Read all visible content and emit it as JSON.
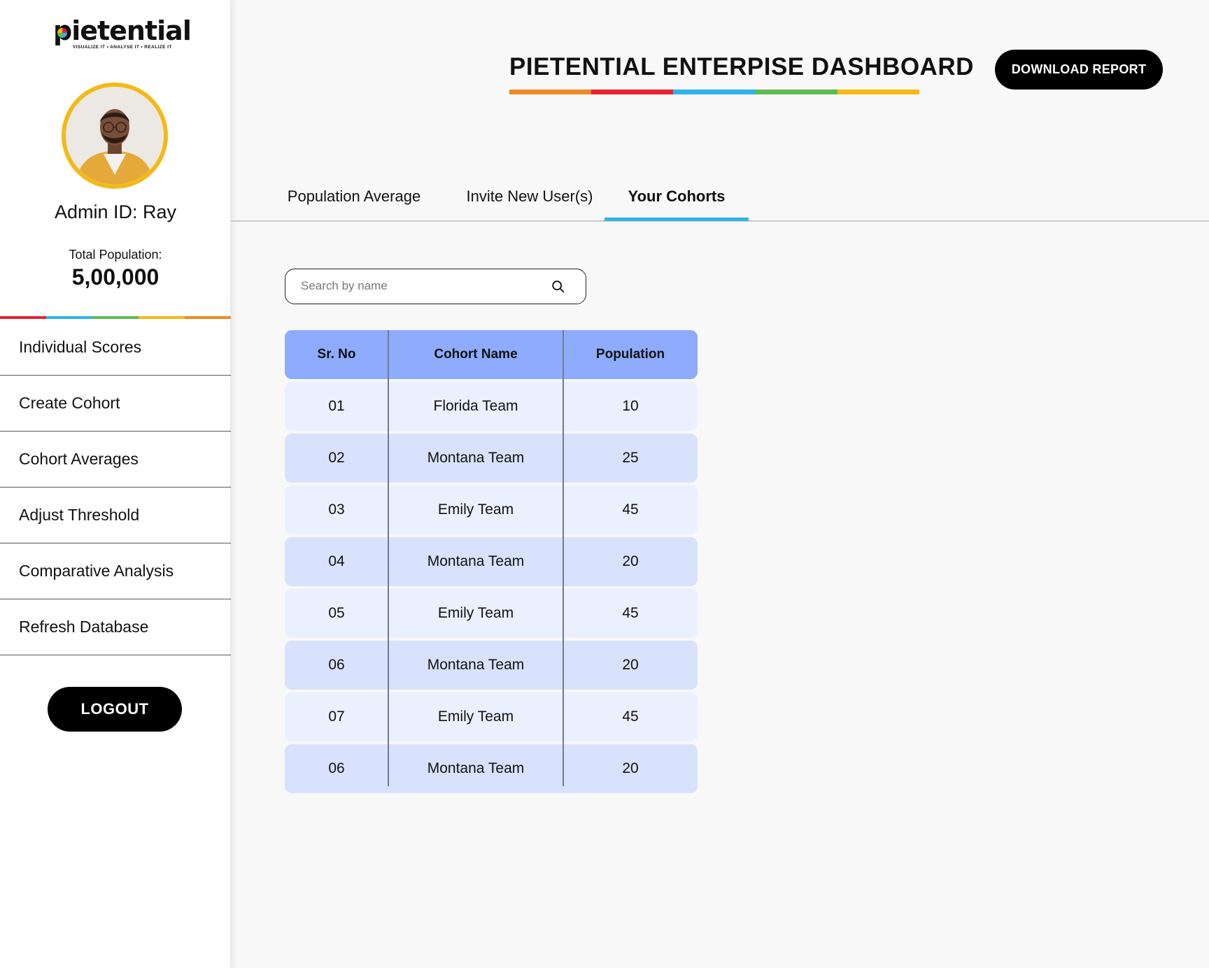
{
  "brand": {
    "name": "pietential",
    "tagline": "VISUALIZE IT • ANALYSE IT • REALIZE IT",
    "rainbow_colors": [
      "#e8222e",
      "#2fb3ea",
      "#5bbd52",
      "#f5b915",
      "#f08a24"
    ]
  },
  "sidebar": {
    "admin_id": "Admin ID: Ray",
    "total_population_label": "Total Population:",
    "total_population_value": "5,00,000",
    "avatar_border_color": "#f5b915",
    "nav_items": [
      {
        "label": "Individual Scores"
      },
      {
        "label": "Create Cohort"
      },
      {
        "label": "Cohort Averages"
      },
      {
        "label": "Adjust Threshold"
      },
      {
        "label": "Comparative Analysis"
      },
      {
        "label": "Refresh Database"
      }
    ],
    "logout_label": "LOGOUT"
  },
  "header": {
    "title": "PIETENTIAL ENTERPISE DASHBOARD",
    "underline_colors": [
      "#f08a24",
      "#e8222e",
      "#2fb3ea",
      "#5bbd52",
      "#f5b915"
    ],
    "download_label": "DOWNLOAD REPORT"
  },
  "tabs": {
    "items": [
      {
        "label": "Population Average"
      },
      {
        "label": "Invite New User(s)"
      },
      {
        "label": "Your Cohorts"
      }
    ],
    "active": "Your Cohorts",
    "active_color": "#2fb3ea"
  },
  "search": {
    "placeholder": "Search by name",
    "value": ""
  },
  "table": {
    "columns": [
      "Sr. No",
      "Cohort Name",
      "Population"
    ],
    "header_color": "#8eabfc",
    "rows": [
      {
        "sr": "01",
        "name": "Florida Team",
        "population": "10"
      },
      {
        "sr": "02",
        "name": "Montana Team",
        "population": "25"
      },
      {
        "sr": "03",
        "name": "Emily Team",
        "population": "45"
      },
      {
        "sr": "04",
        "name": "Montana Team",
        "population": "20"
      },
      {
        "sr": "05",
        "name": "Emily Team",
        "population": "45"
      },
      {
        "sr": "06",
        "name": "Montana Team",
        "population": "20"
      },
      {
        "sr": "07",
        "name": "Emily Team",
        "population": "45"
      },
      {
        "sr": "06",
        "name": "Montana Team",
        "population": "20"
      }
    ]
  }
}
